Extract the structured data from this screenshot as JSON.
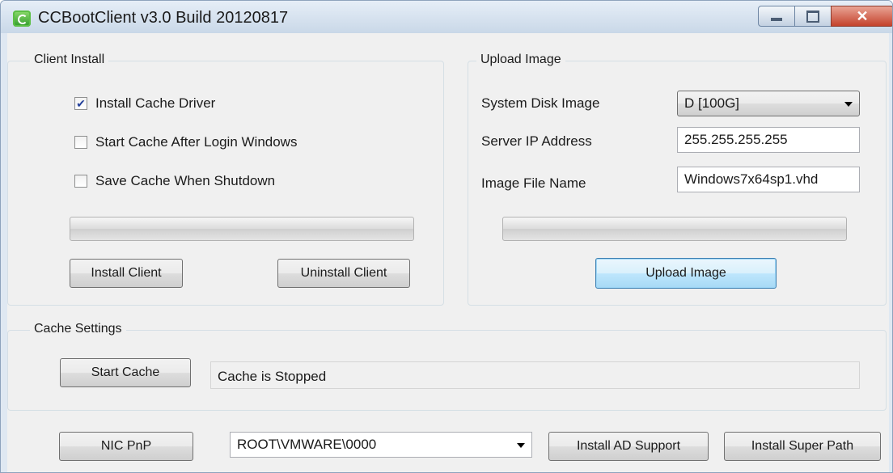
{
  "window": {
    "title": "CCBootClient v3.0 Build 20120817"
  },
  "client_install": {
    "title": "Client Install",
    "options": [
      {
        "label": "Install Cache Driver",
        "checked": true
      },
      {
        "label": "Start Cache After Login Windows",
        "checked": false
      },
      {
        "label": "Save Cache When Shutdown",
        "checked": false
      }
    ],
    "progress": 0,
    "install_label": "Install Client",
    "uninstall_label": "Uninstall Client"
  },
  "upload_image": {
    "title": "Upload Image",
    "system_disk_label": "System Disk Image",
    "system_disk_value": "D [100G]",
    "server_ip_label": "Server IP Address",
    "server_ip_value": "255.255.255.255",
    "file_name_label": "Image File Name",
    "file_name_value": "Windows7x64sp1.vhd",
    "progress": 0,
    "upload_label": "Upload Image"
  },
  "cache_settings": {
    "title": "Cache Settings",
    "start_label": "Start Cache",
    "status_text": "Cache is Stopped"
  },
  "bottom": {
    "nic_label": "NIC PnP",
    "device_value": "ROOT\\VMWARE\\0000",
    "ad_label": "Install AD Support",
    "super_path_label": "Install Super Path"
  }
}
